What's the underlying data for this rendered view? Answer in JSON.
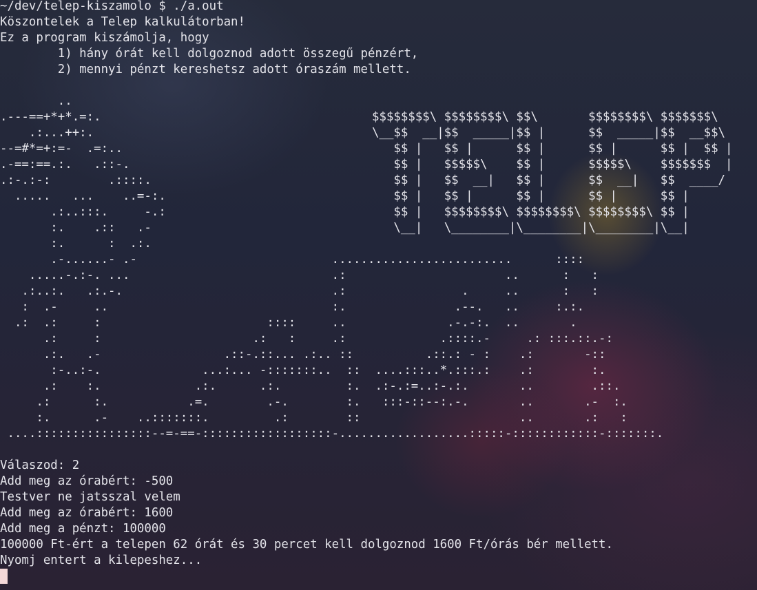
{
  "prompt": "~/dev/telep-kiszamolo $ ./a.out",
  "welcome": "Köszontelek a Telep kalkulátorban!",
  "intro": "Ez a program kiszámolja, hogy",
  "option1": "        1) hány órát kell dolgoznod adott összegű pénzért,",
  "option2": "        2) mennyi pénzt kereshetsz adott óraszám mellett.",
  "ascii_art_left": "        ..\n.---==+*+*.=:.\n    .:...++:.\n--=#*=+:=-  .=:..\n.-==:==.:.   .::-.\n.:-.:-:        .::::.\n  .....   ...    ..=-:.\n       .:..:::.     -.:\n       :.    .::   .-\n       :.      :  .:.\n       .-......- .-\n    .....-.:-. ...\n   .:..:.   .:.-.\n   :  .-     ..\n  .:  .:     :\n      .:     :\n      .:.   .-\n       :-..:-.\n      .:    :.\n     .:      :.\n     :.      .-",
  "ascii_art_right": "$$$$$$$$\\ $$$$$$$$\\ $$\\       $$$$$$$$\\ $$$$$$$\\\n\\__$$  __|$$  _____|$$ |      $$  _____|$$  __$$\\\n   $$ |   $$ |      $$ |      $$ |      $$ |  $$ |\n   $$ |   $$$$$\\    $$ |      $$$$$\\    $$$$$$$  |\n   $$ |   $$  __|   $$ |      $$  __|   $$  ____/\n   $$ |   $$ |      $$ |      $$ |      $$ |\n   $$ |   $$$$$$$$\\ $$$$$$$$\\ $$$$$$$$\\ $$ |\n   \\__|   \\________|\\________|\\________|\\__|",
  "ascii_art_bottom": "                                              .........................      ::::\n                                              .:                      ..      :   :\n                                              .:                .     ..      :   :\n                                              :.               .--.   ..     :.:.\n                                     ::::     ..              .-.-:.  ..       .\n                                   .:   :     .:             .::::.-     .: :::.::.-:\n                               .::-.::... .:.. ::          .::.: - :    .:       -::\n                            ...:... -:::::::..  ::  ....:::..*.:::.:    .:        :.\n                           .:.      .:.         :.  .:-.:=..:-.:.       ..        .::.\n                          .=.        .-.        :.   :::-::--:.-.       ..       .-  :.\n                   ..:::::::.         .:        ::                      ..       .:   :\n ....::::::::::::::::--=-==-::::::::::::::::::-..................:::::-::::::::::::-:::::::.",
  "answer": "Válaszod: 2",
  "wage_prompt_1": "Add meg az órabért: -500",
  "warning": "Testver ne jatsszal velem",
  "wage_prompt_2": "Add meg az órabért: 1600",
  "money_prompt": "Add meg a pénzt: 100000",
  "result": "100000 Ft-ért a telepen 62 órát és 30 percet kell dolgoznod 1600 Ft/órás bér mellett.",
  "exit_prompt": "Nyomj entert a kilepeshez..."
}
